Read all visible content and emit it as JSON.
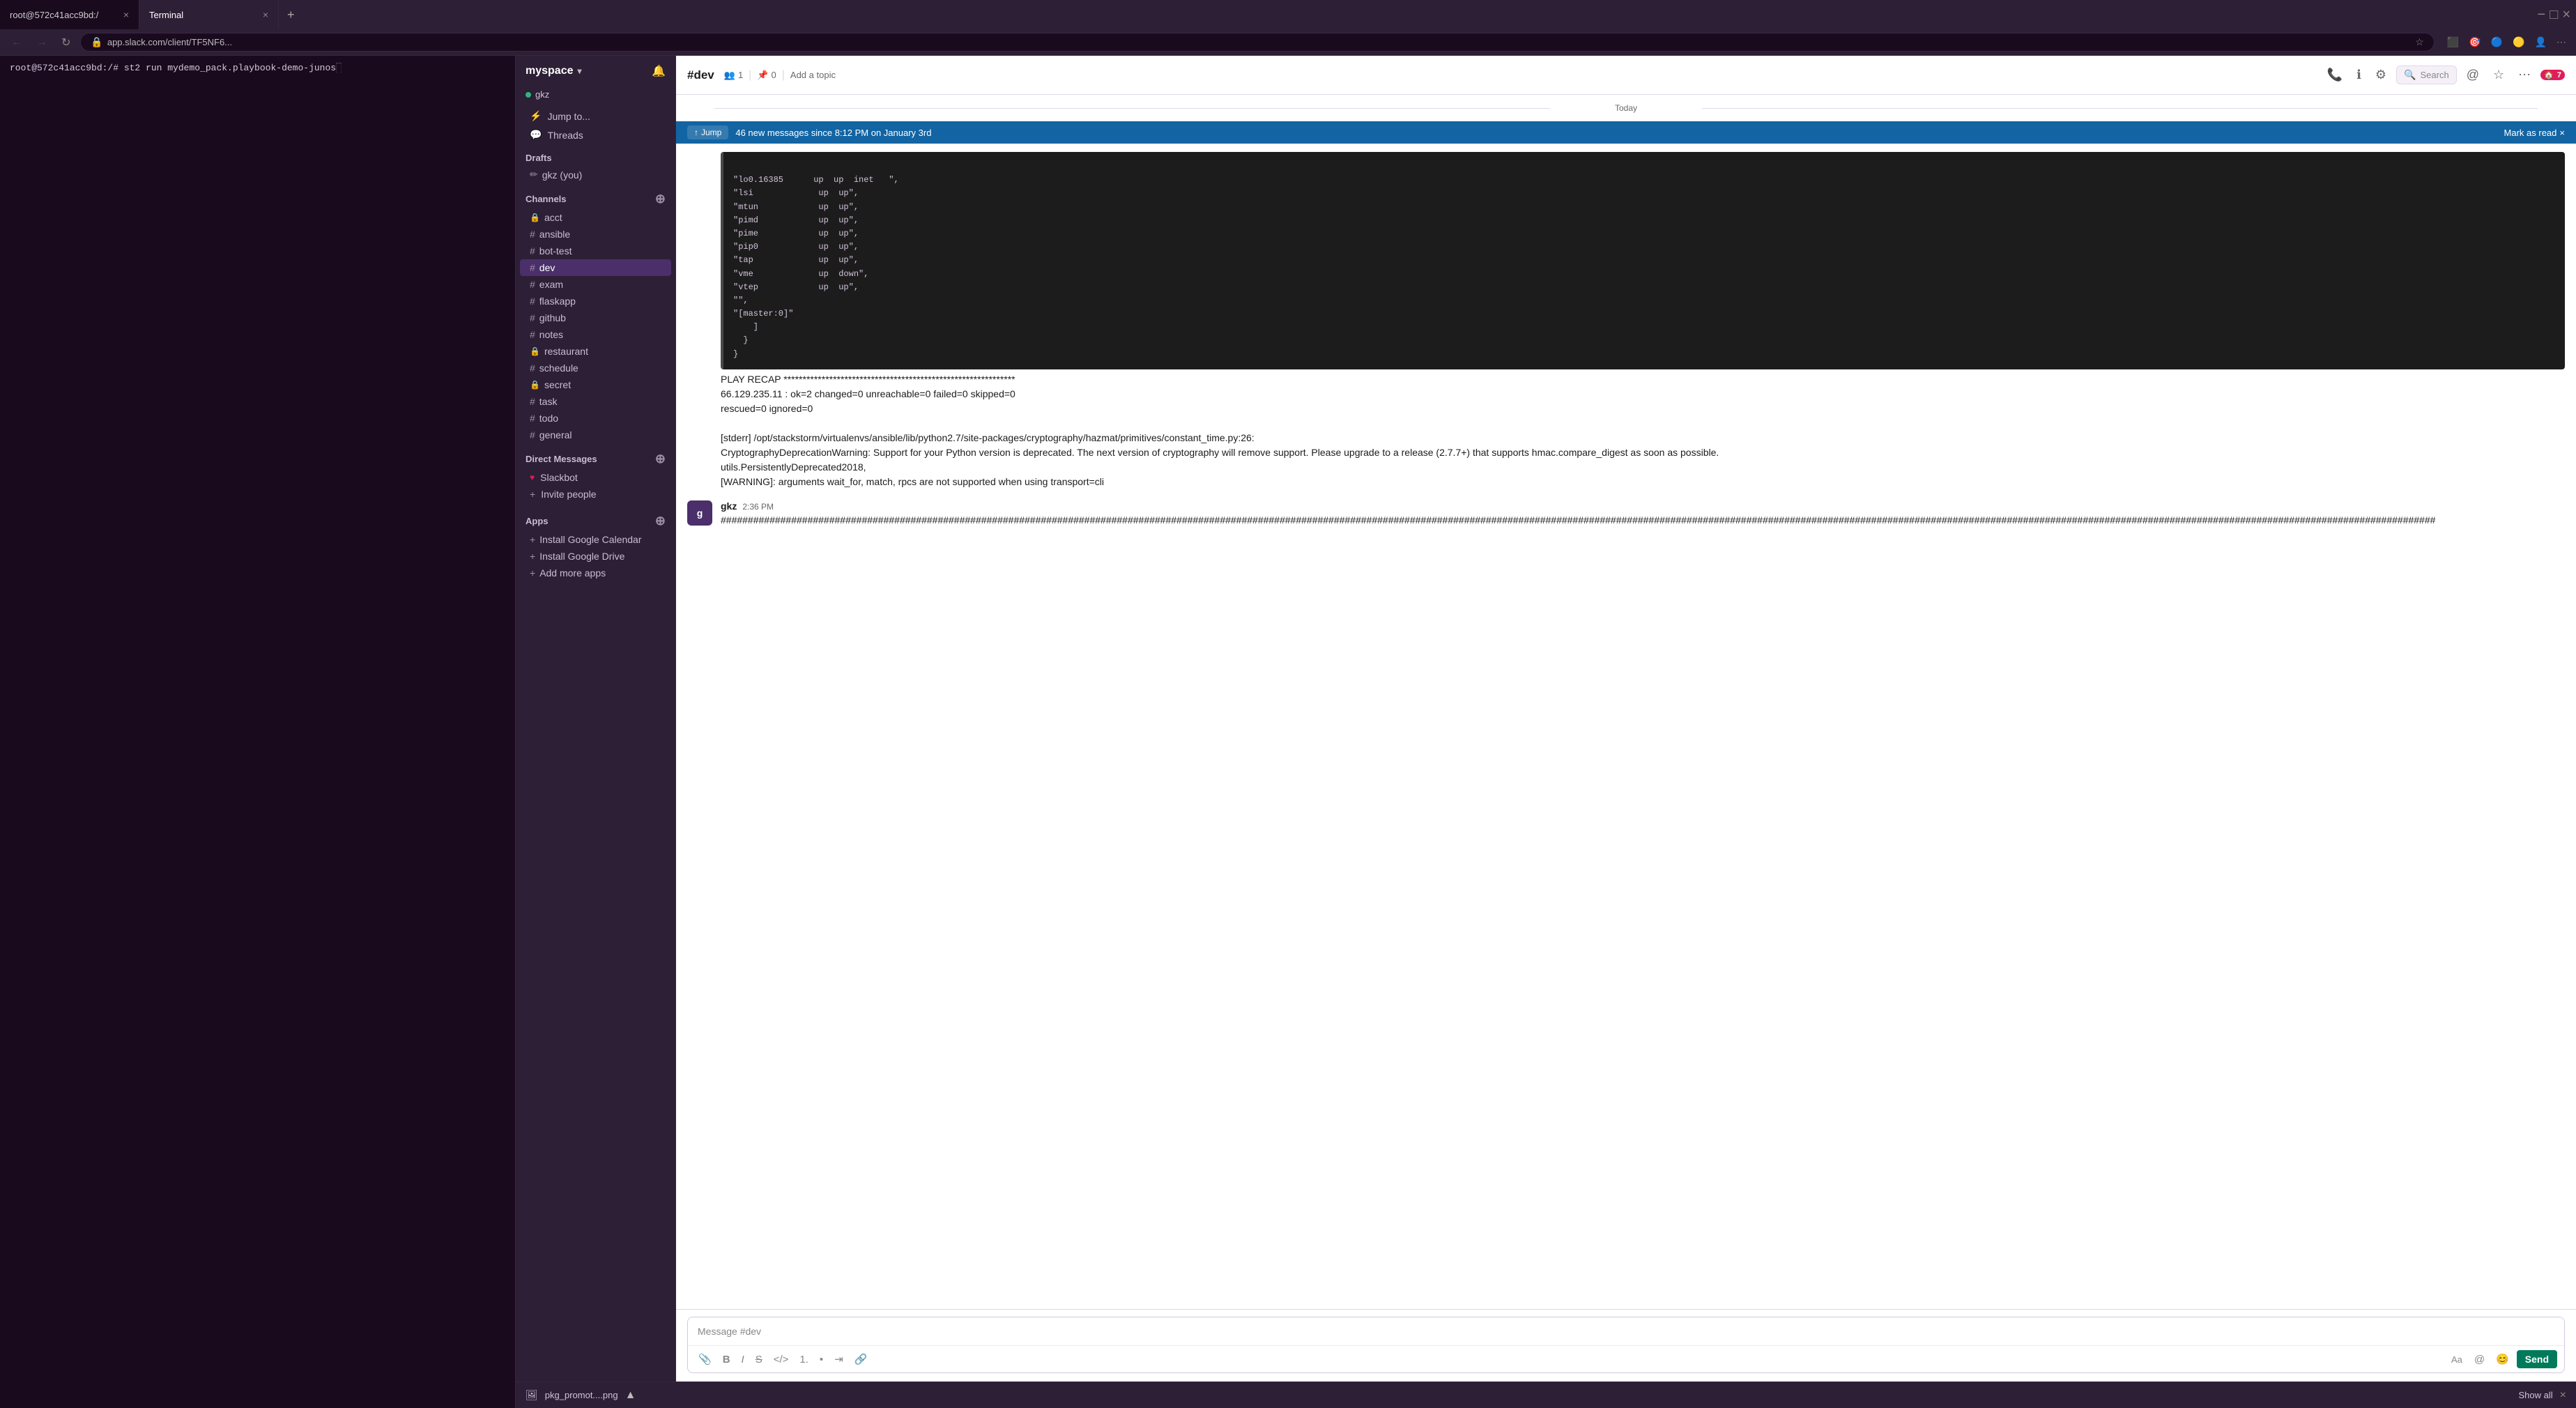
{
  "browser": {
    "tabs": [
      {
        "id": "terminal",
        "label": "root@572c41acc9bd:/",
        "active": false
      },
      {
        "id": "terminal2",
        "label": "Terminal",
        "active": true
      }
    ],
    "address": "app.slack.com/client/TF5NF6...",
    "back_disabled": true,
    "forward_disabled": true
  },
  "terminal": {
    "prompt": "root@572c41acc9bd:/# st2 run mydemo_pack.playbook-demo-junos"
  },
  "sidebar": {
    "workspace": "myspace",
    "status_name": "gkz",
    "jump_to_label": "Jump to...",
    "threads_label": "Threads",
    "drafts_label": "Drafts",
    "drafts_user": "gkz (you)",
    "channels_label": "Channels",
    "channels": [
      {
        "name": "acct",
        "locked": true
      },
      {
        "name": "ansible",
        "locked": false
      },
      {
        "name": "bot-test",
        "locked": false
      },
      {
        "name": "dev",
        "locked": false,
        "active": true
      },
      {
        "name": "exam",
        "locked": false
      },
      {
        "name": "flaskapp",
        "locked": false
      },
      {
        "name": "github",
        "locked": false
      },
      {
        "name": "notes",
        "locked": false
      },
      {
        "name": "restaurant",
        "locked": true
      },
      {
        "name": "schedule",
        "locked": false
      },
      {
        "name": "secret",
        "locked": true
      },
      {
        "name": "task",
        "locked": false
      },
      {
        "name": "todo",
        "locked": false
      },
      {
        "name": "general",
        "locked": false
      }
    ],
    "direct_messages_label": "Direct Messages",
    "dm_list": [
      {
        "name": "Slackbot",
        "heart": true
      }
    ],
    "invite_people_label": "Invite people",
    "apps_label": "Apps",
    "apps_install": [
      "Install Google Calendar",
      "Install Google Drive",
      "Add more apps"
    ]
  },
  "chat": {
    "channel_name": "#dev",
    "meta": {
      "members": "1",
      "pins": "0",
      "add_topic": "Add a topic"
    },
    "search_placeholder": "Search",
    "today_label": "Today",
    "new_messages_banner": {
      "jump_label": "Jump",
      "arrow": "↑",
      "text": "46 new messages since 8:12 PM on January 3rd",
      "mark_read": "Mark as read",
      "close": "×"
    },
    "code_content": {
      "lines": [
        "\"lo0.16385      up  up  inet   \",",
        "\"lsi             up  up\",",
        "\"mtun            up  up\",",
        "\"pimd            up  up\",",
        "\"pime            up  up\",",
        "\"pip0            up  up\",",
        "\"tap             up  up\",",
        "\"vme             up  down\",",
        "\"vtep            up  up\",",
        "\"\",",
        "\"[master:0]\"",
        "    ]",
        "  }",
        "}"
      ]
    },
    "play_recap": {
      "header": "PLAY RECAP *****************************************************",
      "host_line": "66.129.235.11          : ok=2   changed=0   unreachable=0   failed=0   skipped=0",
      "rescued_line": "rescued=0    ignored=0"
    },
    "stderr_lines": [
      "[stderr] /opt/stackstorm/virtualenvs/ansible/lib/python2.7/site-packages/cryptography/hazmat/primitives/constant_time.py:26:",
      "CryptographyDeprecationWarning: Support for your Python version is deprecated. The next version of cryptography will remove support. Please upgrade to a release (2.7.7+) that supports hmac.compare_digest as soon as possible.",
      " utils.PersistentlyDeprecated2018,",
      "[WARNING]: arguments wait_for, match, rpcs are not supported when using transport=cli"
    ],
    "message2": {
      "sender": "gkz",
      "time": "2:36 PM",
      "text": "############################################################################################################################################################################################################################################################################################################################"
    },
    "input_placeholder": "Message #dev",
    "send_label": "Send"
  },
  "bottom_bar": {
    "file_name": "pkg_promot....png",
    "show_all": "Show all"
  },
  "icons": {
    "back": "←",
    "forward": "→",
    "refresh": "↻",
    "star": "☆",
    "bell": "🔔",
    "search": "🔍",
    "phone": "📞",
    "info": "ℹ",
    "gear": "⚙",
    "mention": "@",
    "bookmark": "🔖",
    "more": "⋯",
    "attach": "📎",
    "bold": "B",
    "italic": "I",
    "strike": "S̶",
    "code": "</>",
    "ol": "1.",
    "ul": "•",
    "indent": "⇥",
    "link": "🔗",
    "emoji": "😊",
    "aa": "Aa",
    "arrow_up": "↑",
    "hash": "#",
    "lock": "🔒",
    "heart": "♥",
    "plus": "+",
    "chevron_down": "▾",
    "image_file": "🖼"
  }
}
